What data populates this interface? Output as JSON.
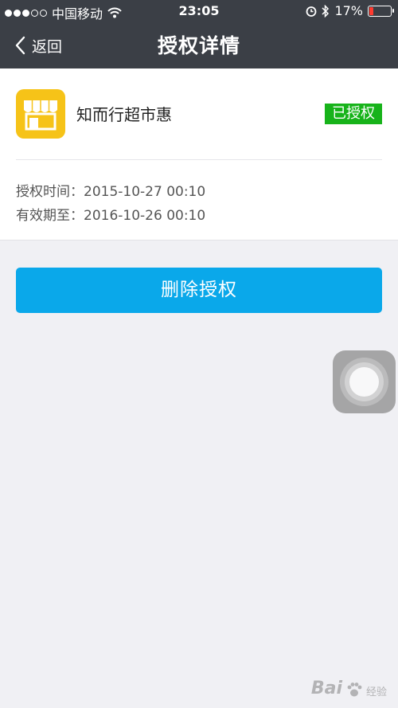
{
  "status_bar": {
    "carrier": "中国移动",
    "time": "23:05",
    "battery_percent_text": "17%",
    "battery_level": 0.17,
    "signal_bars_filled": 3,
    "signal_bars_total": 5,
    "icons": [
      "wifi-icon",
      "alarm-icon",
      "bluetooth-icon",
      "battery-icon"
    ]
  },
  "nav": {
    "back_label": "返回",
    "title": "授权详情"
  },
  "app": {
    "name": "知而行超市惠",
    "icon_name": "store-icon",
    "icon_color": "#f6c318",
    "status": "已授权",
    "status_color": "#17b31a"
  },
  "auth": {
    "time_label": "授权时间：",
    "time_value": "2015-10-27 00:10",
    "expiry_label": "有效期至：",
    "expiry_value": "2016-10-26 00:10"
  },
  "actions": {
    "delete_label": "删除授权",
    "delete_color": "#0aa8ea"
  },
  "watermark": {
    "brand": "Bai",
    "sub": "经验"
  },
  "colors": {
    "header_bg": "#3b3f46",
    "page_bg": "#f0f0f4"
  }
}
